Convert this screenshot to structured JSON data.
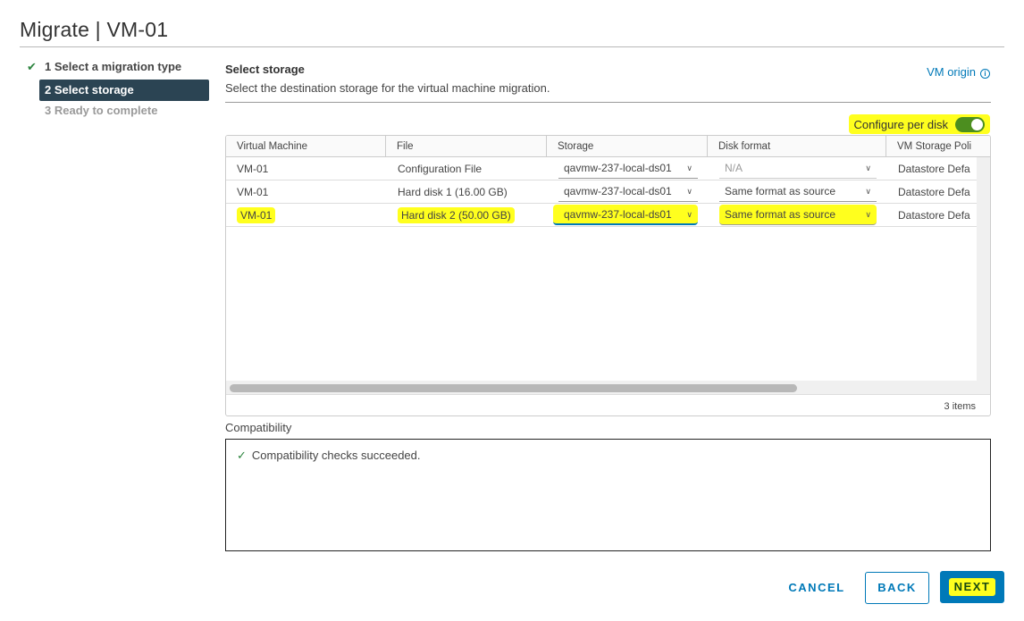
{
  "title": "Migrate | VM-01",
  "steps": [
    {
      "label": "1 Select a migration type",
      "state": "done"
    },
    {
      "label": "2 Select storage",
      "state": "active"
    },
    {
      "label": "3 Ready to complete",
      "state": "pending"
    }
  ],
  "section": {
    "title": "Select storage",
    "description": "Select the destination storage for the virtual machine migration.",
    "vm_origin_link": "VM origin"
  },
  "configure_per_disk": {
    "label": "Configure per disk",
    "enabled": true
  },
  "grid": {
    "columns": [
      "Virtual Machine",
      "File",
      "Storage",
      "Disk format",
      "VM Storage Poli"
    ],
    "rows": [
      {
        "vm": "VM-01",
        "file": "Configuration File",
        "storage": "qavmw-237-local-ds01",
        "disk_format": "N/A",
        "policy": "Datastore Defa"
      },
      {
        "vm": "VM-01",
        "file": "Hard disk 1 (16.00 GB)",
        "storage": "qavmw-237-local-ds01",
        "disk_format": "Same format as source",
        "policy": "Datastore Defa"
      },
      {
        "vm": "VM-01",
        "file": "Hard disk 2 (50.00 GB)",
        "storage": "qavmw-237-local-ds01",
        "disk_format": "Same format as source",
        "policy": "Datastore Defa"
      }
    ],
    "item_count": "3 items"
  },
  "compatibility": {
    "label": "Compatibility",
    "message": "Compatibility checks succeeded."
  },
  "buttons": {
    "cancel": "CANCEL",
    "back": "BACK",
    "next": "NEXT"
  },
  "colors": {
    "accent": "#0079b8",
    "step_active": "#2b4453",
    "success": "#2e8540",
    "highlight": "#ffff1e",
    "toggle_on": "#4c8e1f"
  }
}
